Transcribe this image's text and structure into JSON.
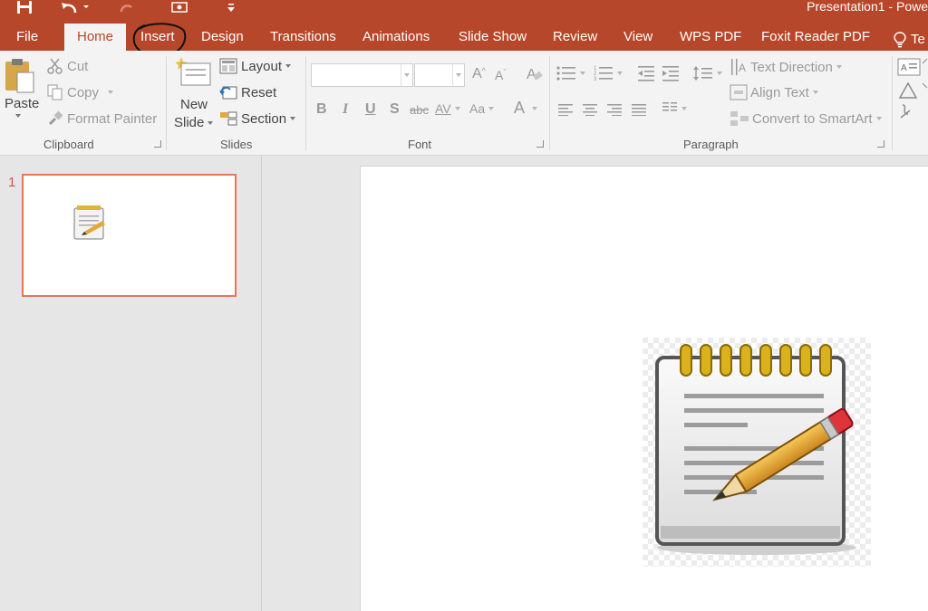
{
  "window": {
    "title": "Presentation1 - Powe"
  },
  "tabs": [
    {
      "id": "file",
      "label": "File"
    },
    {
      "id": "home",
      "label": "Home"
    },
    {
      "id": "insert",
      "label": "Insert"
    },
    {
      "id": "design",
      "label": "Design"
    },
    {
      "id": "transitions",
      "label": "Transitions"
    },
    {
      "id": "animations",
      "label": "Animations"
    },
    {
      "id": "slideshow",
      "label": "Slide Show"
    },
    {
      "id": "review",
      "label": "Review"
    },
    {
      "id": "view",
      "label": "View"
    },
    {
      "id": "wpspdf",
      "label": "WPS PDF"
    },
    {
      "id": "foxit",
      "label": "Foxit Reader PDF"
    },
    {
      "id": "tellme",
      "label": "Te"
    }
  ],
  "active_tab": "Home",
  "ribbon": {
    "clipboard": {
      "label": "Clipboard",
      "paste": "Paste",
      "cut": "Cut",
      "copy": "Copy",
      "format_painter": "Format Painter"
    },
    "slides": {
      "label": "Slides",
      "new_slide_line1": "New",
      "new_slide_line2": "Slide",
      "layout": "Layout",
      "reset": "Reset",
      "section": "Section"
    },
    "font": {
      "label": "Font",
      "bold": "B",
      "italic": "I",
      "underline": "U",
      "shadow": "S",
      "strike": "abc",
      "spacing": "AV",
      "case": "Aa",
      "color": "A"
    },
    "paragraph": {
      "label": "Paragraph",
      "text_direction": "Text Direction",
      "align_text": "Align Text",
      "smartart": "Convert to SmartArt"
    }
  },
  "slides_panel": {
    "slide_number": "1"
  },
  "colors": {
    "accent": "#b7472a",
    "thumb_border": "#e2785a"
  }
}
